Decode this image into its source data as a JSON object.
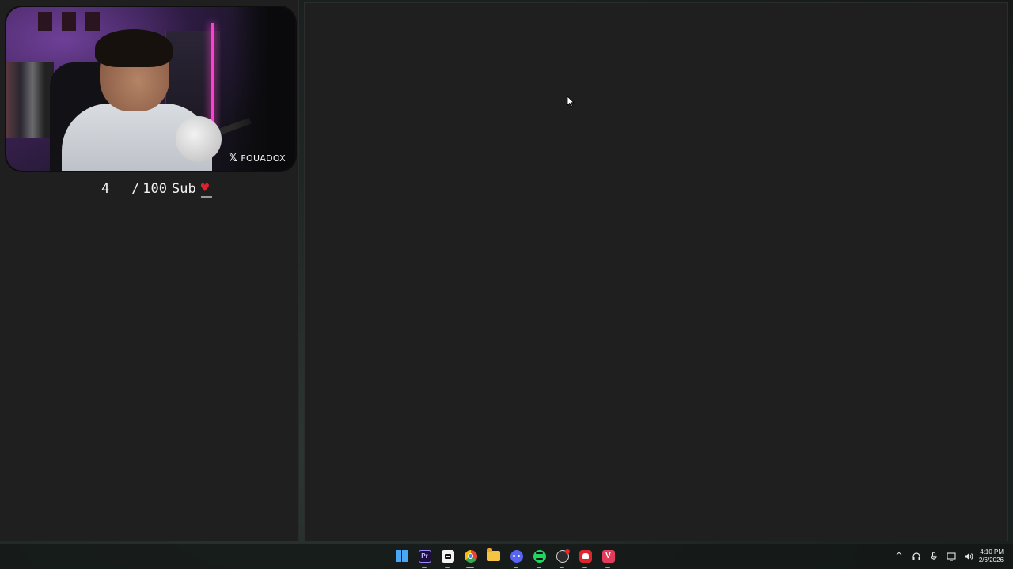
{
  "overlay": {
    "watermark": "FOUADOX",
    "sub_count": "4",
    "sub_slash": "/",
    "sub_goal": "100",
    "sub_label": "Sub",
    "heart": "♥"
  },
  "taskbar": {
    "apps": [
      {
        "name": "start",
        "icon": "windows-icon"
      },
      {
        "name": "premiere-pro",
        "icon": "premiere-icon",
        "label": "Pr"
      },
      {
        "name": "capcut",
        "icon": "capcut-icon"
      },
      {
        "name": "chrome",
        "icon": "chrome-icon",
        "active": true
      },
      {
        "name": "file-explorer",
        "icon": "folder-icon"
      },
      {
        "name": "discord",
        "icon": "discord-icon"
      },
      {
        "name": "spotify",
        "icon": "spotify-icon"
      },
      {
        "name": "obs",
        "icon": "obs-icon"
      },
      {
        "name": "red-app",
        "icon": "red-app-icon"
      },
      {
        "name": "pink-app",
        "icon": "pink-app-icon",
        "label": "V"
      }
    ],
    "tray": {
      "chevron": "^",
      "headphones": "headphones-icon",
      "mic": "microphone-icon",
      "network": "network-icon",
      "volume": "volume-icon"
    },
    "time": "4:10 PM",
    "date": "2/6/2026"
  },
  "colors": {
    "window_bg": "#1f1f1f",
    "heart": "#e0202a",
    "active_indicator": "#6fb6ff"
  }
}
